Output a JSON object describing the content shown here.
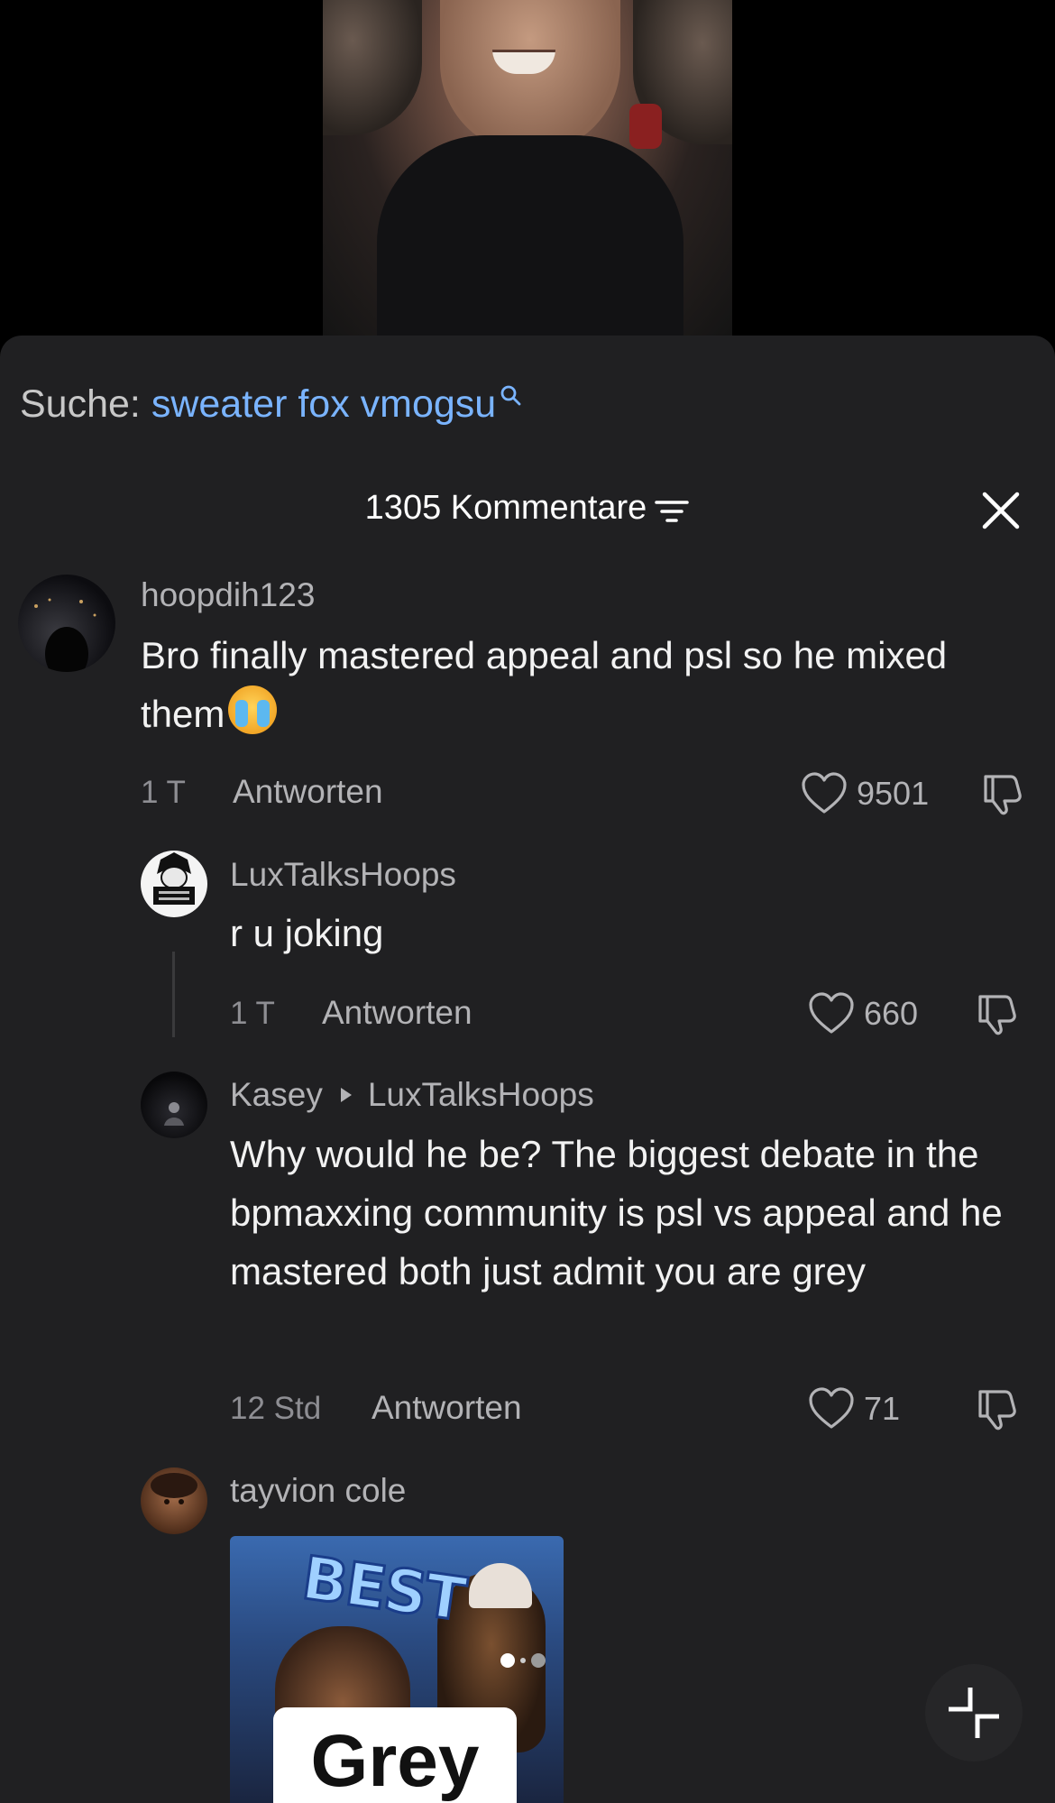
{
  "search": {
    "label": "Suche:",
    "term": "sweater fox vmogsu"
  },
  "comments_header": {
    "title": "1305 Kommentare"
  },
  "comments": [
    {
      "username": "hoopdih123",
      "text": "Bro finally mastered appeal and psl so he mixed them",
      "time": "1 T",
      "reply_label": "Antworten",
      "likes": "9501"
    },
    {
      "username": "LuxTalksHoops",
      "text": "r u joking",
      "time": "1 T",
      "reply_label": "Antworten",
      "likes": "660"
    },
    {
      "username": "Kasey",
      "reply_to": "LuxTalksHoops",
      "text": "Why would he be? The biggest debate in the bpmaxxing community is psl vs appeal and he mastered both just admit you are grey",
      "time": "12 Std",
      "reply_label": "Antworten",
      "likes": "71"
    },
    {
      "username": "tayvion cole",
      "attachment": {
        "headline": "BEST",
        "label": "Grey"
      }
    }
  ],
  "icons": {
    "search": "search-icon",
    "filter": "filter-icon",
    "close": "close-icon",
    "like": "heart-icon",
    "dislike": "thumbs-down-icon",
    "collapse": "collapse-icon"
  },
  "colors": {
    "sheet_bg": "#202022",
    "search_link": "#7ab4ff",
    "muted_text": "#b3b3b6"
  }
}
